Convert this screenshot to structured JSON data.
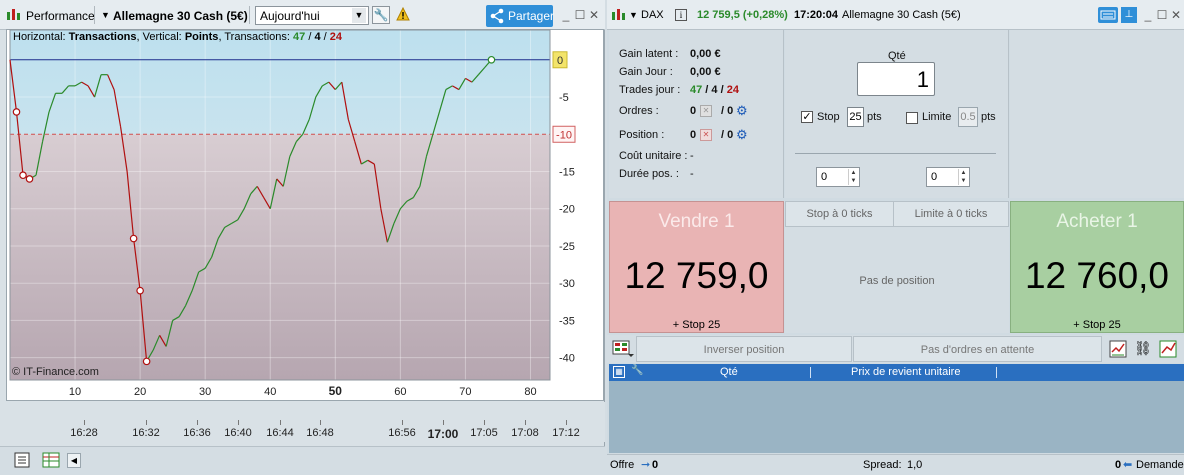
{
  "left_toolbar": {
    "performance_label": "Performance",
    "instrument_label": "Allemagne 30 Cash (5€)",
    "period_value": "Aujourd'hui",
    "share_label": "Partager"
  },
  "chart_info": {
    "prefix": "Horizontal:",
    "h_value": "Transactions",
    "v_prefix": ", Vertical:",
    "v_value": "Points",
    "t_prefix": ", Transactions:",
    "t_total": "47",
    "t_sep1": " / ",
    "t_win": "4",
    "t_sep2": " / ",
    "t_loss": "24",
    "watermark": "© IT-Finance.com"
  },
  "chart_data": {
    "type": "line",
    "x_axis_label": "Transactions",
    "y_axis_label": "Points",
    "xlim": [
      0,
      83
    ],
    "ylim": [
      -43,
      4
    ],
    "xticks": [
      "10",
      "20",
      "30",
      "40",
      "50",
      "60",
      "70",
      "80"
    ],
    "yticks": [
      "-5",
      "-15",
      "-20",
      "-25",
      "-30",
      "-35",
      "-40"
    ],
    "zero_marker": "0",
    "threshold_marker": "-10",
    "threshold": -10,
    "time_ticks": [
      "16:28",
      "16:32",
      "16:36",
      "16:40",
      "16:44",
      "16:48",
      "16:56",
      "17:00",
      "17:05",
      "17:08",
      "17:12"
    ],
    "colors": {
      "up": "#2a8a2a",
      "down": "#b01010",
      "zero_line": "#1c2c8c",
      "threshold_line": "#d05050"
    },
    "series": [
      {
        "x": 0,
        "y": 0
      },
      {
        "x": 1,
        "y": -7
      },
      {
        "x": 2,
        "y": -15.5
      },
      {
        "x": 3,
        "y": -16
      },
      {
        "x": 4,
        "y": -15.5
      },
      {
        "x": 5,
        "y": -11
      },
      {
        "x": 6,
        "y": -7
      },
      {
        "x": 7,
        "y": -4.5
      },
      {
        "x": 8,
        "y": -4.5
      },
      {
        "x": 9,
        "y": -3.5
      },
      {
        "x": 10,
        "y": -3.5
      },
      {
        "x": 11,
        "y": -3
      },
      {
        "x": 12,
        "y": -3.5
      },
      {
        "x": 13,
        "y": -5
      },
      {
        "x": 14,
        "y": -2
      },
      {
        "x": 15,
        "y": -2
      },
      {
        "x": 16,
        "y": -4
      },
      {
        "x": 17,
        "y": -9
      },
      {
        "x": 18,
        "y": -15
      },
      {
        "x": 19,
        "y": -24
      },
      {
        "x": 20,
        "y": -31
      },
      {
        "x": 21,
        "y": -40.5
      },
      {
        "x": 22,
        "y": -39
      },
      {
        "x": 23,
        "y": -37
      },
      {
        "x": 24,
        "y": -38.5
      },
      {
        "x": 25,
        "y": -35
      },
      {
        "x": 26,
        "y": -34.5
      },
      {
        "x": 27,
        "y": -33
      },
      {
        "x": 28,
        "y": -31
      },
      {
        "x": 29,
        "y": -28.5
      },
      {
        "x": 30,
        "y": -28
      },
      {
        "x": 31,
        "y": -26.5
      },
      {
        "x": 32,
        "y": -24
      },
      {
        "x": 33,
        "y": -22.5
      },
      {
        "x": 34,
        "y": -22
      },
      {
        "x": 35,
        "y": -21.5
      },
      {
        "x": 36,
        "y": -20
      },
      {
        "x": 37,
        "y": -18
      },
      {
        "x": 38,
        "y": -17
      },
      {
        "x": 39,
        "y": -18.5
      },
      {
        "x": 40,
        "y": -20
      },
      {
        "x": 41,
        "y": -16
      },
      {
        "x": 42,
        "y": -17
      },
      {
        "x": 43,
        "y": -13
      },
      {
        "x": 44,
        "y": -11
      },
      {
        "x": 45,
        "y": -10
      },
      {
        "x": 46,
        "y": -8
      },
      {
        "x": 47,
        "y": -5
      },
      {
        "x": 48,
        "y": -3.5
      },
      {
        "x": 49,
        "y": -3
      },
      {
        "x": 50,
        "y": -4
      },
      {
        "x": 51,
        "y": -3
      },
      {
        "x": 52,
        "y": -8
      },
      {
        "x": 53,
        "y": -11
      },
      {
        "x": 54,
        "y": -14
      },
      {
        "x": 55,
        "y": -13.5
      },
      {
        "x": 56,
        "y": -14
      },
      {
        "x": 57,
        "y": -20
      },
      {
        "x": 58,
        "y": -24.5
      },
      {
        "x": 59,
        "y": -22
      },
      {
        "x": 60,
        "y": -20
      },
      {
        "x": 61,
        "y": -19
      },
      {
        "x": 62,
        "y": -18.5
      },
      {
        "x": 63,
        "y": -17
      },
      {
        "x": 64,
        "y": -13
      },
      {
        "x": 65,
        "y": -10
      },
      {
        "x": 66,
        "y": -7
      },
      {
        "x": 67,
        "y": -4
      },
      {
        "x": 68,
        "y": -3.5
      },
      {
        "x": 69,
        "y": -4
      },
      {
        "x": 70,
        "y": -2.5
      },
      {
        "x": 71,
        "y": -3
      },
      {
        "x": 72,
        "y": -2
      },
      {
        "x": 73,
        "y": -1
      },
      {
        "x": 74,
        "y": 0
      }
    ],
    "markers": [
      {
        "x": 1,
        "y": -7
      },
      {
        "x": 2,
        "y": -15.5
      },
      {
        "x": 3,
        "y": -16
      },
      {
        "x": 19,
        "y": -24
      },
      {
        "x": 20,
        "y": -31
      },
      {
        "x": 21,
        "y": -40.5
      },
      {
        "x": 74,
        "y": 0
      }
    ]
  },
  "right_header": {
    "symbol": "DAX",
    "change": "12 759,5 (+0,28%)",
    "time": "17:20:04",
    "instrument": "Allemagne 30 Cash (5€)"
  },
  "stats": {
    "gain_latent_label": "Gain latent :",
    "gain_latent_value": "0,00 €",
    "gain_jour_label": "Gain Jour :",
    "gain_jour_value": "0,00 €",
    "trades_label": "Trades jour :",
    "trades_total": "47",
    "trades_win": "4",
    "trades_loss": "24",
    "slash": " / ",
    "ordres_label": "Ordres :",
    "ordres_a": "0",
    "ordres_b": "/ 0",
    "position_label": "Position :",
    "position_a": "0",
    "position_b": "/ 0",
    "cout_label": "Coût unitaire :",
    "cout_value": "-",
    "duree_label": "Durée pos. :",
    "duree_value": "-"
  },
  "order": {
    "qty_label": "Qté",
    "qty_value": "1",
    "stop_label": "Stop",
    "stop_value": "25",
    "stop_unit": "pts",
    "limit_label": "Limite",
    "limit_value": "0.5",
    "limit_unit": "pts",
    "spin_left": "0",
    "spin_right": "0"
  },
  "trade": {
    "sell_label": "Vendre 1",
    "sell_price": "12 759,0",
    "sell_stop": "+ Stop 25",
    "buy_label": "Acheter 1",
    "buy_price": "12 760,0",
    "buy_stop": "+ Stop 25",
    "stop_ticks": "Stop à 0 ticks",
    "limit_ticks": "Limite à 0 ticks",
    "no_position": "Pas de position"
  },
  "actions": {
    "reverse": "Inverser position",
    "no_orders": "Pas d'ordres en attente"
  },
  "table": {
    "col_qty": "Qté",
    "col_price": "Prix de revient unitaire"
  },
  "status": {
    "offre_label": "Offre",
    "offre_value": "0",
    "spread_label": "Spread:",
    "spread_value": "1,0",
    "demande_value": "0",
    "demande_label": "Demande"
  }
}
